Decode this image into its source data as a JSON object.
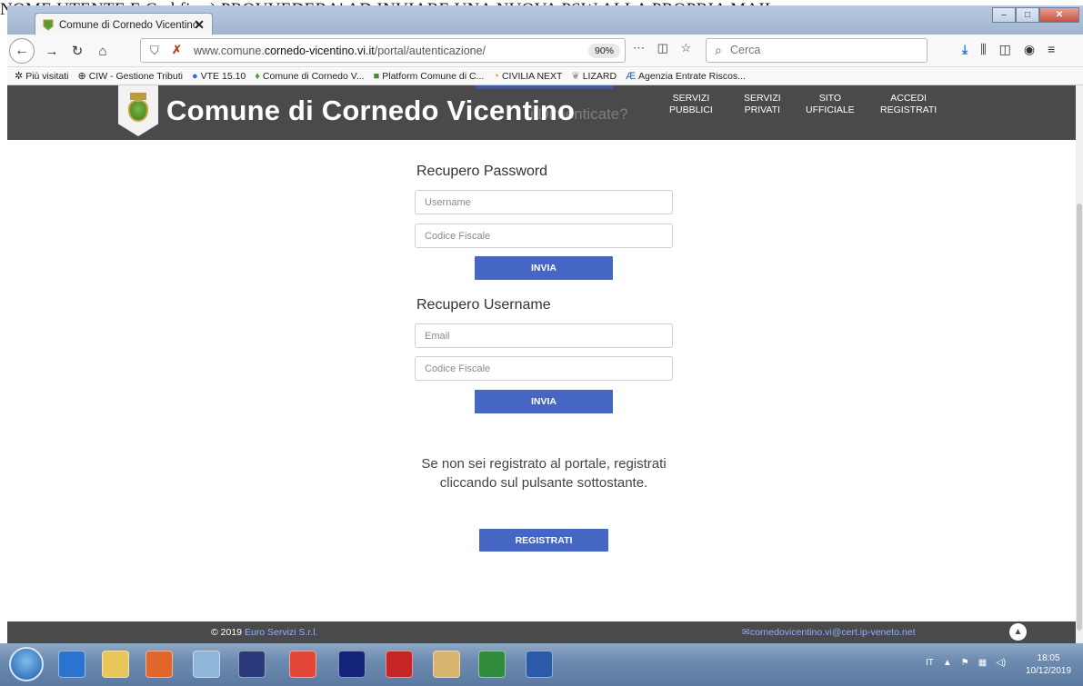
{
  "document_strip": {
    "text": "NOME UTENTE E Cod.fisc.) PROVVEDERA' AD INVIARE UNA NUOVA PSW ALLA PROPRIA MAIL"
  },
  "browser": {
    "tab_title": "Comune di Cornedo Vicentino",
    "tab_close": "✕",
    "url_prefix": "www.comune.",
    "url_domain": "cornedo-vicentino.vi.it",
    "url_path": "/portal/autenticazione/",
    "zoom": "90%",
    "search_placeholder": "Cerca",
    "bookmarks": [
      {
        "label": "Più visitati",
        "icon": "gear-icon"
      },
      {
        "label": "CIW - Gestione Tributi",
        "icon": "globe-icon"
      },
      {
        "label": "VTE 15.10",
        "icon": "circle-icon"
      },
      {
        "label": "Comune di Cornedo V...",
        "icon": "crest-icon"
      },
      {
        "label": "Platform Comune di C...",
        "icon": "platform-icon"
      },
      {
        "label": "CIVILIA NEXT",
        "icon": "civilia-icon"
      },
      {
        "label": "LIZARD",
        "icon": "lizard-icon"
      },
      {
        "label": "Agenzia Entrate Riscos...",
        "icon": "ae-icon"
      }
    ]
  },
  "site": {
    "title": "Comune di Cornedo Vicentino",
    "overlap_text": "i Dimenticate?",
    "nav": [
      {
        "line1": "SERVIZI",
        "line2": "PUBBLICI"
      },
      {
        "line1": "SERVIZI",
        "line2": "PRIVATI"
      },
      {
        "line1": "SITO",
        "line2": "UFFICIALE"
      },
      {
        "line1": "ACCEDI",
        "line2": "REGISTRATI"
      }
    ]
  },
  "password_recovery": {
    "heading": "Recupero Password",
    "username_placeholder": "Username",
    "cf_placeholder": "Codice Fiscale",
    "submit": "INVIA"
  },
  "username_recovery": {
    "heading": "Recupero Username",
    "email_placeholder": "Email",
    "cf_placeholder": "Codice Fiscale",
    "submit": "INVIA"
  },
  "register": {
    "notice": "Se non sei registrato al portale, registrati cliccando sul pulsante sottostante.",
    "button": "REGISTRATI"
  },
  "footer": {
    "copyright": "© 2019",
    "company": "Euro Servizi S.r.l.",
    "email": "cornedovicentino.vi@cert.ip-veneto.net",
    "top_icon": "chevron-up-icon"
  },
  "taskbar": {
    "lang": "IT",
    "time": "18:05",
    "date": "10/12/2019"
  },
  "colors": {
    "header_bg": "#4a4a4a",
    "button_blue": "#4566c2",
    "link_blue": "#8fb0ff"
  }
}
